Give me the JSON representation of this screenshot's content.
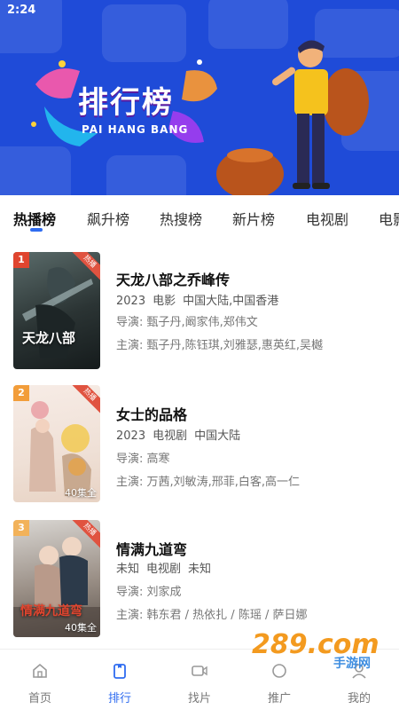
{
  "status_bar": {
    "time": "2:24"
  },
  "banner": {
    "title": "排行榜",
    "subtitle": "PAI HANG BANG"
  },
  "tabs": [
    {
      "label": "热播榜",
      "active": true
    },
    {
      "label": "飙升榜"
    },
    {
      "label": "热搜榜"
    },
    {
      "label": "新片榜"
    },
    {
      "label": "电视剧"
    },
    {
      "label": "电影"
    }
  ],
  "items": [
    {
      "rank": "1",
      "rank_color": "#e0452f",
      "hot_tag": "热播",
      "title": "天龙八部之乔峰传",
      "meta": [
        "2023",
        "电影",
        "中国大陆,中国香港"
      ],
      "director_label": "导演:",
      "director": "甄子丹,阚家伟,郑伟文",
      "cast_label": "主演:",
      "cast": "甄子丹,陈钰琪,刘雅瑟,惠英红,吴樾",
      "episodes": "",
      "poster_text": "天龙八部"
    },
    {
      "rank": "2",
      "rank_color": "#f29d3a",
      "hot_tag": "热播",
      "title": "女士的品格",
      "meta": [
        "2023",
        "电视剧",
        "中国大陆"
      ],
      "director_label": "导演:",
      "director": "高寒",
      "cast_label": "主演:",
      "cast": "万茜,刘敏涛,邢菲,白客,高一仁",
      "episodes": "40集全",
      "poster_text": ""
    },
    {
      "rank": "3",
      "rank_color": "#f2b25a",
      "hot_tag": "热播",
      "title": "情满九道弯",
      "meta": [
        "未知",
        "电视剧",
        "未知"
      ],
      "director_label": "导演:",
      "director": "刘家成",
      "cast_label": "主演:",
      "cast": "韩东君 / 热依扎 / 陈瑶 / 萨日娜",
      "episodes": "40集全",
      "poster_text": "情满九道弯"
    }
  ],
  "bottom_nav": [
    {
      "label": "首页",
      "icon": "home-icon"
    },
    {
      "label": "排行",
      "icon": "ranking-icon",
      "active": true
    },
    {
      "label": "找片",
      "icon": "video-icon"
    },
    {
      "label": "推广",
      "icon": "share-icon"
    },
    {
      "label": "我的",
      "icon": "profile-icon"
    }
  ],
  "watermark": {
    "text": "289.com",
    "sub": "手游网"
  },
  "colors": {
    "accent": "#2f6cf0",
    "banner_bg": "#1f4bd8"
  }
}
